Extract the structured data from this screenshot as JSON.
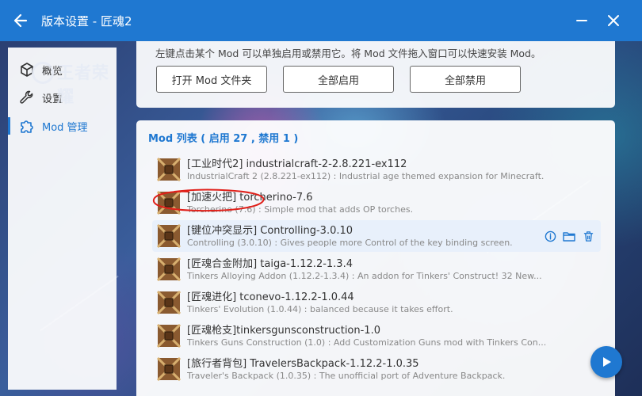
{
  "titlebar": {
    "title": "版本设置 - 匠魂2"
  },
  "sidebar": {
    "items": [
      {
        "label": "概览",
        "icon": "cube-icon"
      },
      {
        "label": "设置",
        "icon": "wrench-icon"
      },
      {
        "label": "Mod 管理",
        "icon": "puzzle-icon"
      }
    ],
    "watermark": "王者荣耀"
  },
  "top_card": {
    "hint": "左键点击某个 Mod 可以单独启用或禁用它。将 Mod 文件拖入窗口可以快速安装 Mod。",
    "buttons": {
      "open_folder": "打开 Mod 文件夹",
      "enable_all": "全部启用",
      "disable_all": "全部禁用"
    }
  },
  "mod_list": {
    "title": "Mod 列表 ( 启用 27 , 禁用 1 )",
    "items": [
      {
        "name": "[工业时代2] industrialcraft-2-2.8.221-ex112",
        "desc": "IndustrialCraft 2 (2.8.221-ex112) : Industrial age themed expansion for Minecraft."
      },
      {
        "name": "[加速火把] torcherino-7.6",
        "desc": "Torcherino (7.6) : Simple mod that adds OP torches."
      },
      {
        "name": "[键位冲突显示] Controlling-3.0.10",
        "desc": "Controlling (3.0.10) : Gives people more Control of the key binding screen."
      },
      {
        "name": "[匠魂合金附加] taiga-1.12.2-1.3.4",
        "desc": "Tinkers Alloying Addon (1.12.2-1.3.4) : An addon for Tinkers' Construct! 32 New..."
      },
      {
        "name": "[匠魂进化] tconevo-1.12.2-1.0.44",
        "desc": "Tinkers' Evolution (1.0.44) : balanced because it takes effort."
      },
      {
        "name": "[匠魂枪支]tinkersgunsconstruction-1.0",
        "desc": "Tinkers Guns Construction (1.0) : Add Customization Guns mod with Tinkers Con..."
      },
      {
        "name": "[旅行者背包] TravelersBackpack-1.12.2-1.0.35",
        "desc": "Traveler's Backpack (1.0.35) : The unofficial port of Adventure Backpack."
      }
    ]
  },
  "colors": {
    "accent": "#1f78d1",
    "annotation": "#e0201a"
  }
}
